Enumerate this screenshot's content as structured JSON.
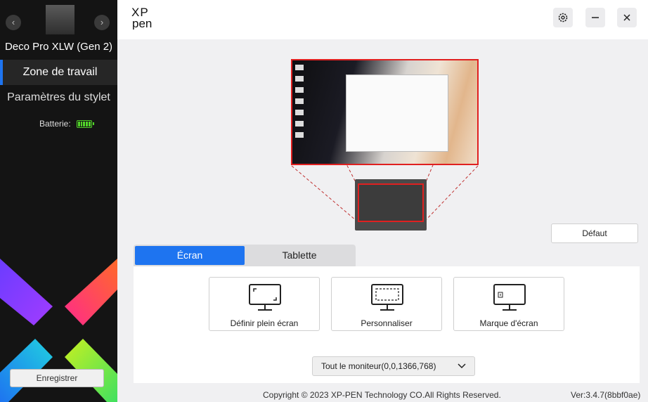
{
  "app": {
    "brand_line1": "XP",
    "brand_line2": "pen"
  },
  "sidebar": {
    "device_name": "Deco Pro XLW (Gen 2)",
    "nav": [
      {
        "label": "Zone de travail",
        "active": true
      },
      {
        "label": "Paramètres du stylet",
        "active": false
      }
    ],
    "battery_label": "Batterie:",
    "battery_level": 1.0,
    "save_label": "Enregistrer"
  },
  "header": {
    "icons": [
      "gear-icon",
      "minimize-icon",
      "close-icon"
    ]
  },
  "preview": {
    "default_label": "Défaut"
  },
  "tabs": [
    {
      "label": "Écran",
      "active": true
    },
    {
      "label": "Tablette",
      "active": false
    }
  ],
  "options": [
    {
      "label": "Définir plein écran",
      "icon": "monitor-fullscreen-icon"
    },
    {
      "label": "Personnaliser",
      "icon": "monitor-custom-icon"
    },
    {
      "label": "Marque d'écran",
      "icon": "monitor-mark-icon"
    }
  ],
  "monitor_select": {
    "value": "Tout le moniteur(0,0,1366,768)"
  },
  "footer": {
    "copyright": "Copyright © 2023  XP-PEN Technology CO.All Rights Reserved.",
    "version": "Ver:3.4.7(8bbf0ae)"
  },
  "colors": {
    "accent": "#1e74f0",
    "area_outline": "#e02020",
    "battery": "#52d42a",
    "sidebar_bg": "#141414"
  }
}
